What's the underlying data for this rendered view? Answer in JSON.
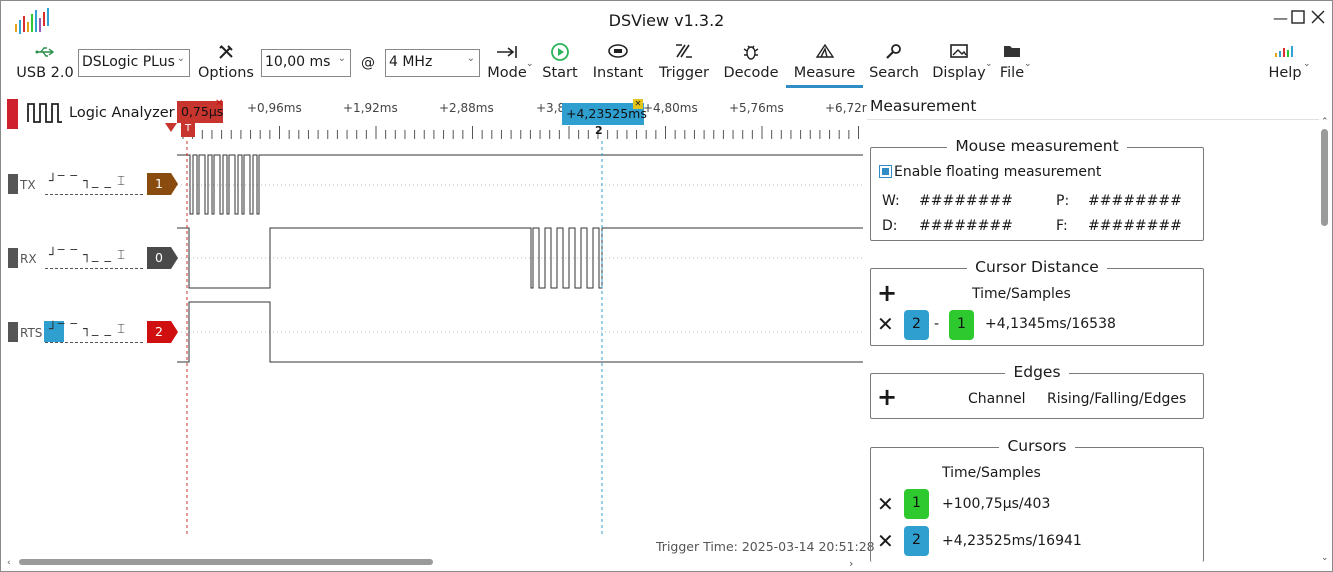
{
  "window": {
    "title": "DSView v1.3.2"
  },
  "colors": {
    "accent": "#2f8cc5",
    "trigger_red": "#d0202e",
    "cursor1_green": "#2dc92f",
    "cursor2_blue": "#2f9fd0",
    "ch1_brown": "#8a4b0f",
    "ch0_dark": "#4a4a4a",
    "ch2_red": "#d01010"
  },
  "toolbar": {
    "usb_label": "USB 2.0",
    "device": "DSLogic PLus",
    "options_label": "Options",
    "duration": "10,00 ms",
    "at": "@",
    "rate": "4 MHz",
    "mode_label": "Mode",
    "start_label": "Start",
    "instant_label": "Instant",
    "trigger_label": "Trigger",
    "decode_label": "Decode",
    "measure_label": "Measure",
    "search_label": "Search",
    "display_label": "Display",
    "file_label": "File",
    "help_label": "Help"
  },
  "icons": {
    "usb": "usb-icon",
    "options": "wrench-icon",
    "mode": "arrow-to-bar-icon",
    "start": "play-circle-icon",
    "instant": "eye-icon",
    "trigger": "trigger-icon",
    "decode": "bug-icon",
    "measure": "prism-icon",
    "search": "magnifier-icon",
    "display": "image-icon",
    "file": "folder-icon",
    "help": "help-icon"
  },
  "analyzer": {
    "title": "Logic Analyzer",
    "trigger_marker": "T",
    "ruler_ticks": [
      "+0,96ms",
      "+1,92ms",
      "+2,88ms",
      "+3,8",
      "+4,80ms",
      "+5,76ms",
      "+6,72r"
    ],
    "cursor1_flag": "0,75µs",
    "cursor2_flag": "+4,23525ms",
    "cursor2_index": "2",
    "channels": [
      {
        "name": "TX",
        "number": "1"
      },
      {
        "name": "RX",
        "number": "0"
      },
      {
        "name": "RTS",
        "number": "2"
      }
    ],
    "trigger_time": "Trigger Time: 2025-03-14 20:51:28"
  },
  "measurement": {
    "panel_title": "Measurement",
    "mouse": {
      "title": "Mouse measurement",
      "enable_label": "Enable floating measurement",
      "w_label": "W:",
      "w_value": "########",
      "p_label": "P:",
      "p_value": "########",
      "d_label": "D:",
      "d_value": "########",
      "f_label": "F:",
      "f_value": "########"
    },
    "cursor_distance": {
      "title": "Cursor Distance",
      "header": "Time/Samples",
      "from": "2",
      "dash": "-",
      "to": "1",
      "value": "+4,1345ms/16538"
    },
    "edges": {
      "title": "Edges",
      "channel_header": "Channel",
      "rfe_header": "Rising/Falling/Edges"
    },
    "cursors": {
      "title": "Cursors",
      "header": "Time/Samples",
      "rows": [
        {
          "id": "1",
          "value": "+100,75µs/403"
        },
        {
          "id": "2",
          "value": "+4,23525ms/16941"
        }
      ]
    }
  }
}
